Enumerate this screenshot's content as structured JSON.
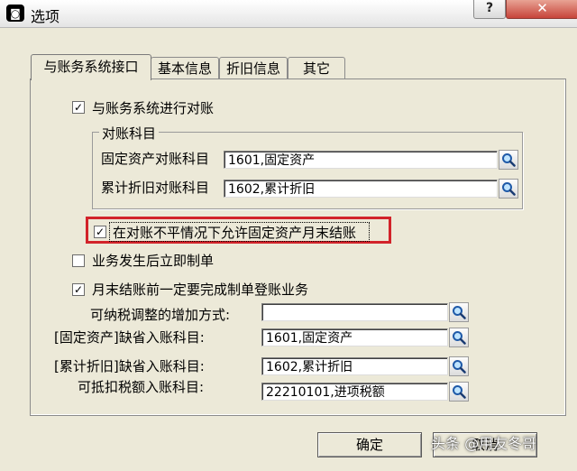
{
  "window": {
    "title": "选项",
    "app_icon_glyph": "◙",
    "help_label": "?",
    "close_label": "✕"
  },
  "tabs": [
    {
      "label": "与账务系统接口",
      "active": true
    },
    {
      "label": "基本信息",
      "active": false
    },
    {
      "label": "折旧信息",
      "active": false
    },
    {
      "label": "其它",
      "active": false
    }
  ],
  "reconcile": {
    "checkbox_label": "与账务系统进行对账",
    "checked": true,
    "group_title": "对账科目",
    "fixed_asset_label": "固定资产对账科目",
    "fixed_asset_value": "1601,固定资产",
    "depreciation_label": "累计折旧对账科目",
    "depreciation_value": "1602,累计折旧"
  },
  "options": {
    "allow_close_label": "在对账不平情况下允许固定资产月末结账",
    "allow_close_checked": true,
    "immediate_voucher_label": "业务发生后立即制单",
    "immediate_voucher_checked": false,
    "must_post_label": "月末结账前一定要完成制单登账业务",
    "must_post_checked": true
  },
  "defaults": {
    "tax_adjust_label": "可纳税调整的增加方式:",
    "tax_adjust_value": "",
    "fixed_asset_label": "[固定资产]缺省入账科目:",
    "fixed_asset_value": "1601,固定资产",
    "depreciation_label": "[累计折旧]缺省入账科目:",
    "depreciation_value": "1602,累计折旧",
    "deductible_tax_label": "可抵扣税额入账科目:",
    "deductible_tax_value": "22210101,进项税额"
  },
  "buttons": {
    "ok_label": "确定",
    "cancel_label": "取消"
  },
  "watermark": "头条 @用友冬哥",
  "icons": {
    "search": "magnifier-icon",
    "check": "✓"
  },
  "colors": {
    "dialog_bg": "#ece9d8",
    "highlight": "#d2232a",
    "close_button": "#c7443a"
  }
}
